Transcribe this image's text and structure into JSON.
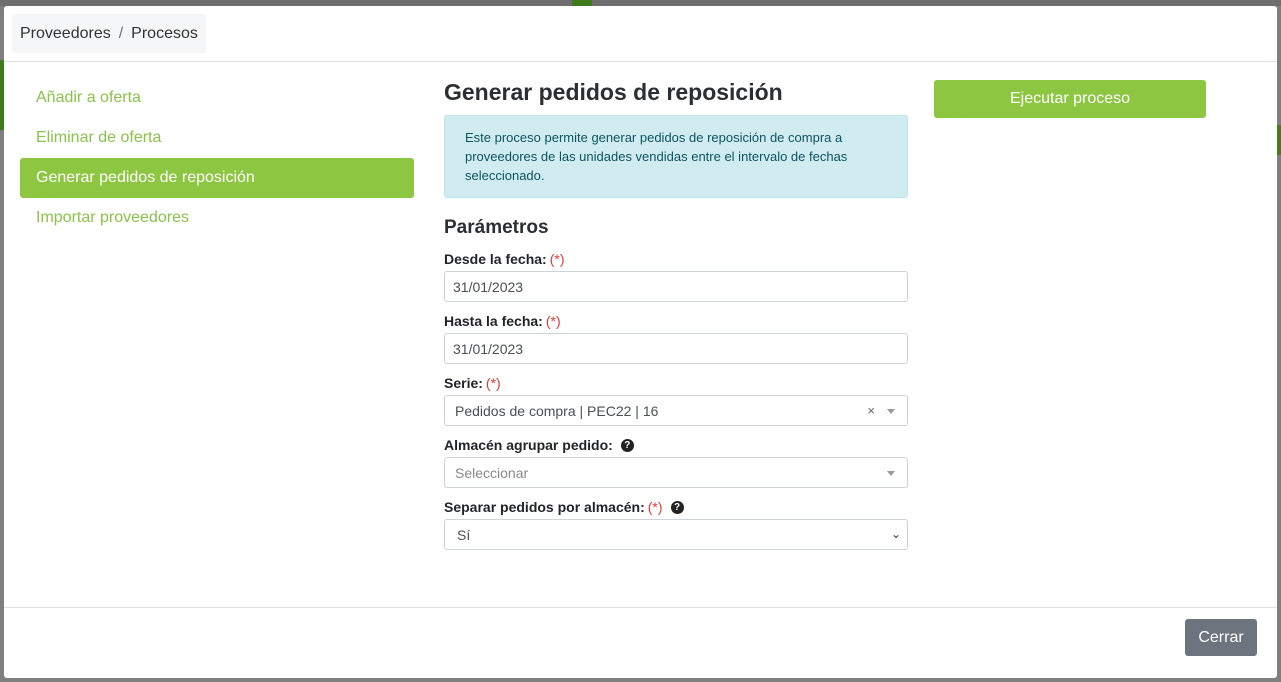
{
  "breadcrumb": {
    "items": [
      "Proveedores",
      "Procesos"
    ],
    "separator": "/"
  },
  "nav": {
    "items": [
      {
        "label": "Añadir a oferta",
        "active": false
      },
      {
        "label": "Eliminar de oferta",
        "active": false
      },
      {
        "label": "Generar pedidos de reposición",
        "active": true
      },
      {
        "label": "Importar proveedores",
        "active": false
      }
    ]
  },
  "process": {
    "title": "Generar pedidos de reposición",
    "description": "Este proceso permite generar pedidos de reposición de compra a proveedores de las unidades vendidas entre el intervalo de fechas seleccionado.",
    "params_heading": "Parámetros",
    "required_mark": "(*)",
    "fields": {
      "desde": {
        "label": "Desde la fecha:",
        "value": "31/01/2023"
      },
      "hasta": {
        "label": "Hasta la fecha:",
        "value": "31/01/2023"
      },
      "serie": {
        "label": "Serie:",
        "value": "Pedidos de compra | PEC22 | 16",
        "clear": "×"
      },
      "almacen": {
        "label": "Almacén agrupar pedido:",
        "placeholder": "Seleccionar"
      },
      "separar": {
        "label": "Separar pedidos por almacén:",
        "value": "Sí"
      }
    }
  },
  "actions": {
    "run_label": "Ejecutar proceso",
    "close_label": "Cerrar"
  },
  "colors": {
    "accent": "#8dc641",
    "info_bg": "#d1ecf1",
    "info_text": "#0c5460",
    "required": "#e53935",
    "secondary": "#6c757d"
  }
}
